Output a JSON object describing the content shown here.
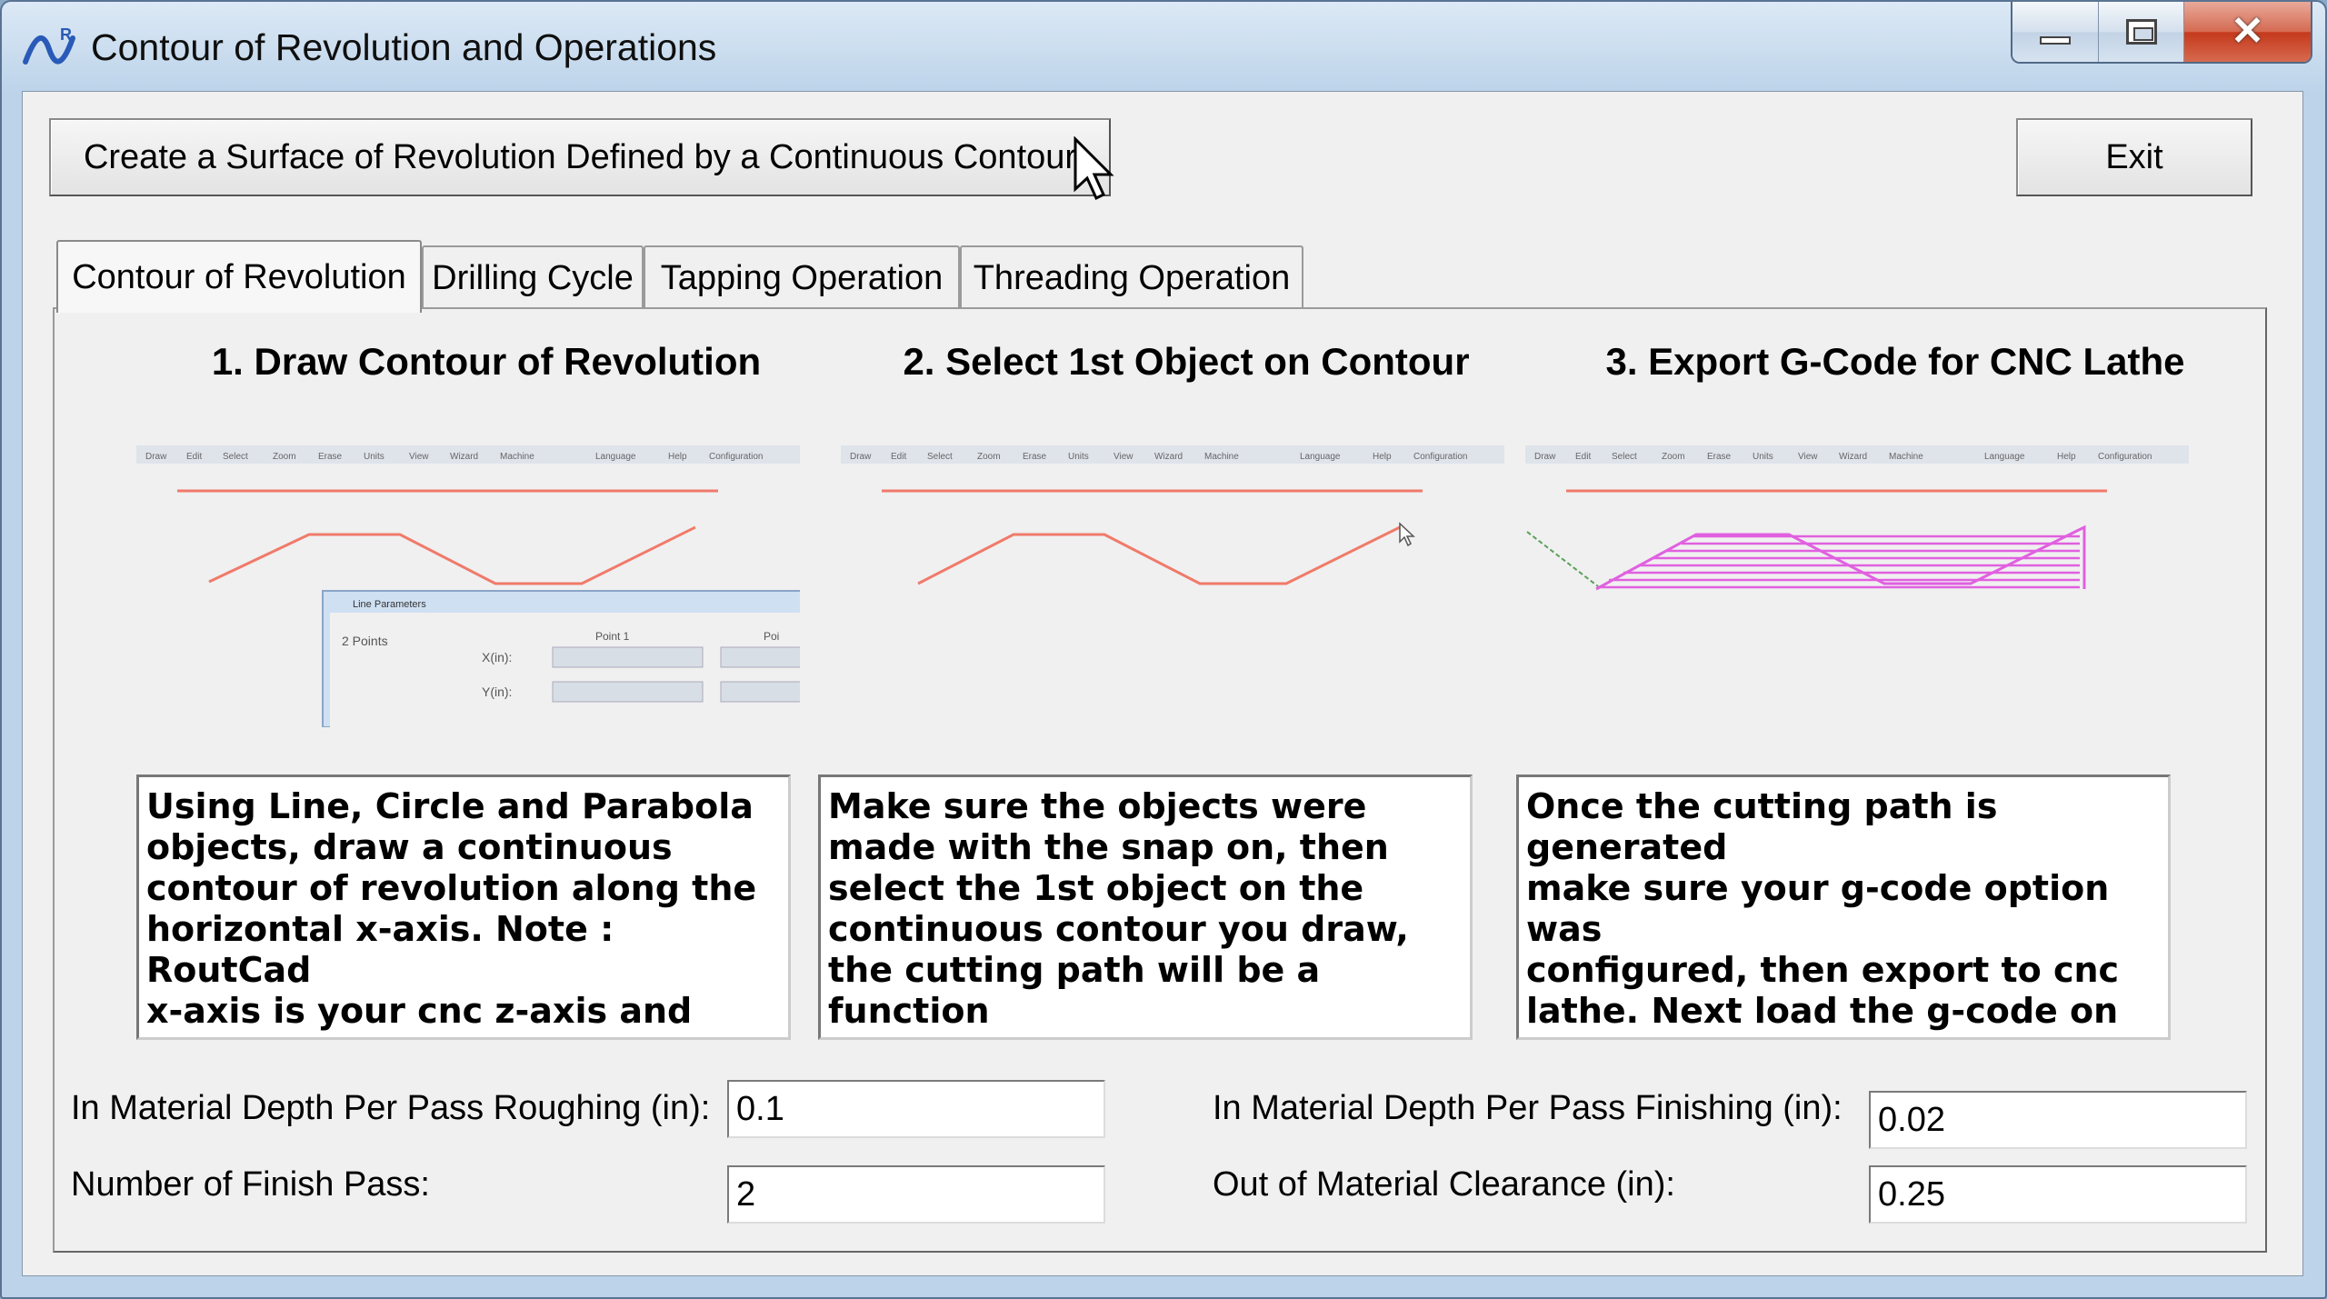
{
  "window": {
    "title": "Contour of Revolution and Operations",
    "controls": {
      "minimize": "minimize",
      "maximize": "maximize",
      "close": "close"
    }
  },
  "toolbar": {
    "create_surface_label": "Create a Surface of Revolution Defined by a Continuous Contour",
    "exit_label": "Exit"
  },
  "tabs": [
    {
      "label": "Contour of Revolution",
      "active": true
    },
    {
      "label": "Drilling Cycle",
      "active": false
    },
    {
      "label": "Tapping Operation",
      "active": false
    },
    {
      "label": "Threading Operation",
      "active": false
    }
  ],
  "steps": [
    {
      "title": "1. Draw Contour of Revolution",
      "description": "Using Line, Circle and Parabola\nobjects, draw a continuous\ncontour  of revolution along the\nhorizontal x-axis. Note : RoutCad\nx-axis is your cnc z-axis and\nRoutCad y-axis is your cnc x-axis."
    },
    {
      "title": "2. Select 1st Object on Contour",
      "description": "Make sure the objects were\nmade with the snap on, then\nselect the 1st object on the\ncontinuous contour you draw,\nthe cutting path will be a function\nof the parameters you set bellow."
    },
    {
      "title": "3. Export G-Code for CNC Lathe",
      "description": "Once the cutting path is generated\nmake sure your g-code option was\nconfigured, then export to cnc\nlathe. Next load the g-code on\nyour cnc controller and machine."
    }
  ],
  "thumbnail": {
    "menu_items": [
      "Draw",
      "Edit",
      "Select",
      "Zoom",
      "Erase",
      "Units",
      "View",
      "Wizard",
      "Machine",
      "Language",
      "Help",
      "Configuration"
    ],
    "dialog_title": "Line Parameters",
    "dialog_option": "2 Points",
    "dialog_col_header": "Point 1",
    "dialog_col_header_2": "Poi",
    "dialog_x_label": "X(in):",
    "dialog_y_label": "Y(in):"
  },
  "params": {
    "roughing_label": "In Material Depth Per Pass Roughing (in):",
    "roughing_value": "0.1",
    "finishing_label": "In Material Depth Per Pass Finishing (in):",
    "finishing_value": "0.02",
    "finish_pass_label": "Number of Finish Pass:",
    "finish_pass_value": "2",
    "clearance_label": "Out of Material Clearance (in):",
    "clearance_value": "0.25"
  },
  "colors": {
    "contour": "#f07a6a",
    "toolpath": "#e060e0",
    "menu_bar": "#dfe3ea"
  }
}
